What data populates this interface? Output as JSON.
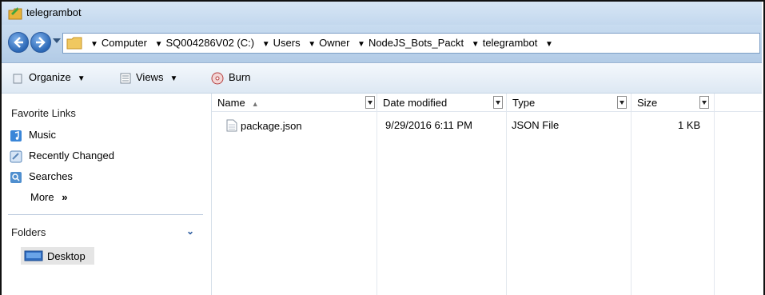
{
  "window": {
    "title": "telegrambot"
  },
  "address": {
    "crumbs": [
      "Computer",
      "SQ004286V02 (C:)",
      "Users",
      "Owner",
      "NodeJS_Bots_Packt",
      "telegrambot"
    ]
  },
  "toolbar": {
    "organize_label": "Organize",
    "views_label": "Views",
    "burn_label": "Burn"
  },
  "sidebar": {
    "favorites_title": "Favorite Links",
    "items": [
      {
        "label": "Music",
        "icon": "music-icon"
      },
      {
        "label": "Recently Changed",
        "icon": "recent-icon"
      },
      {
        "label": "Searches",
        "icon": "search-folder-icon"
      }
    ],
    "more_label": "More",
    "more_glyph": "»",
    "folders_title": "Folders",
    "folders_chevron": "⌄",
    "desktop_label": "Desktop"
  },
  "file_list": {
    "columns": [
      "Name",
      "Date modified",
      "Type",
      "Size"
    ],
    "sort_indicator": "▲",
    "rows": [
      {
        "name": "package.json",
        "date": "9/29/2016 6:11 PM",
        "type": "JSON File",
        "size": "1 KB"
      }
    ]
  },
  "colors": {
    "titlebar": "#c3d8ee",
    "addressbar": "#b2cbe6",
    "accent": "#2b67b5"
  }
}
